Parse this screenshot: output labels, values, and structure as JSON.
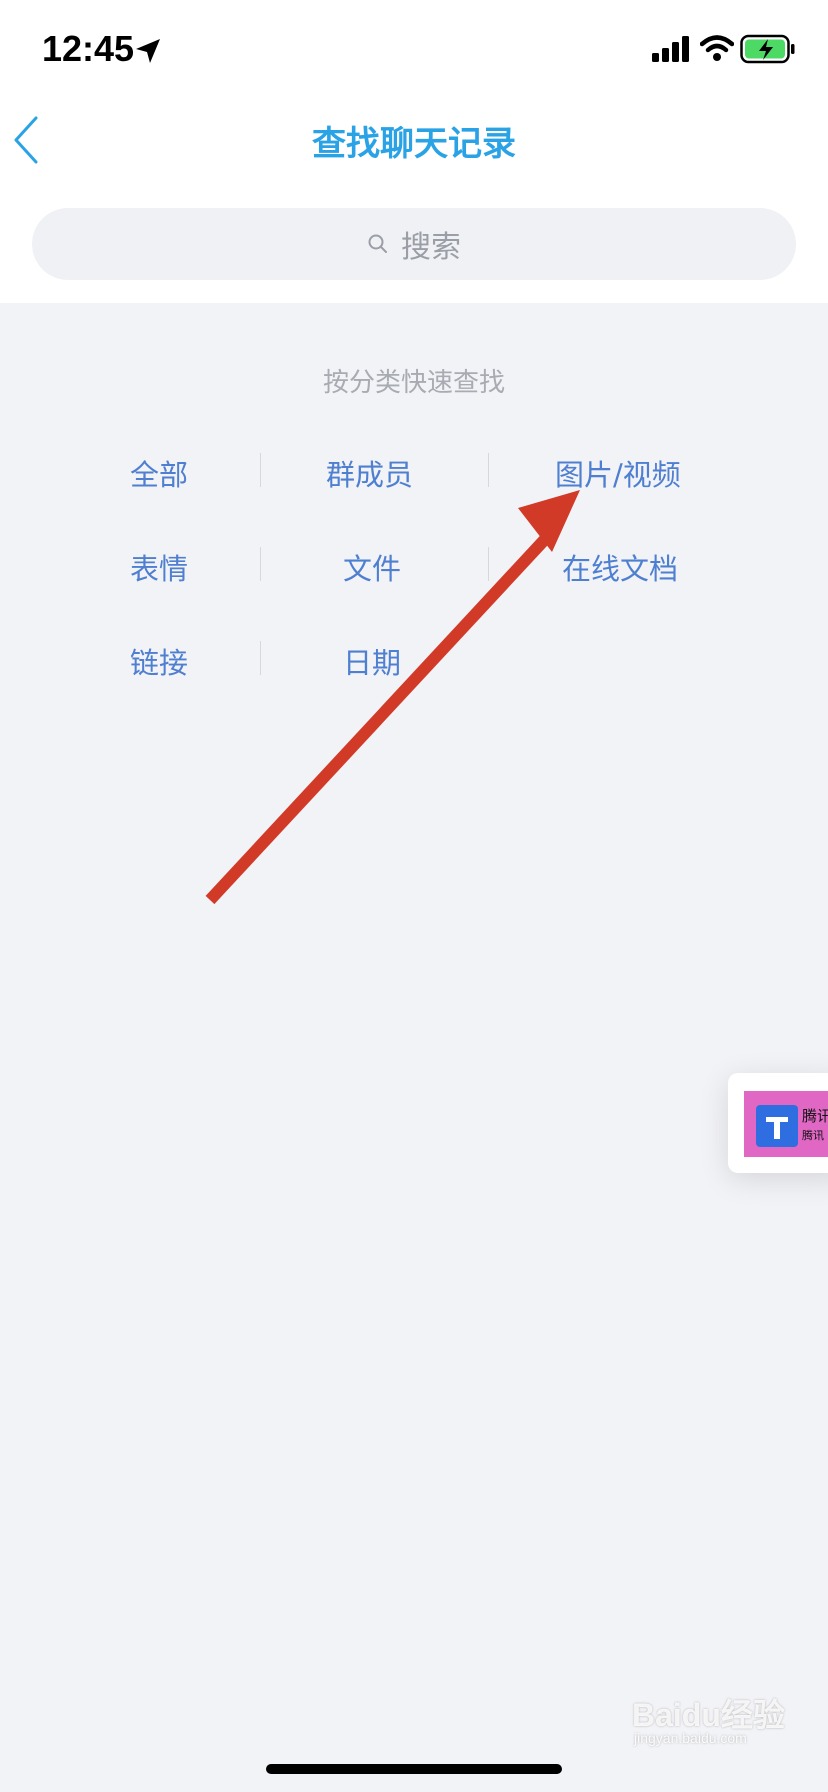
{
  "status_bar": {
    "time": "12:45"
  },
  "header": {
    "title": "查找聊天记录"
  },
  "search": {
    "placeholder": "搜索"
  },
  "categories": {
    "section_label": "按分类快速查找",
    "items": [
      {
        "label": "全部"
      },
      {
        "label": "群成员"
      },
      {
        "label": "图片/视频"
      },
      {
        "label": "表情"
      },
      {
        "label": "文件"
      },
      {
        "label": "在线文档"
      },
      {
        "label": "链接"
      },
      {
        "label": "日期"
      }
    ]
  },
  "floating_card": {
    "title": "腾讯",
    "subtitle": "腾讯"
  },
  "watermark": {
    "brand": "Baidu经验",
    "url": "jingyan.baidu.com"
  },
  "colors": {
    "title_blue": "#2aa2e6",
    "category_blue": "#4f7fd0",
    "annotation_red": "#d23a28",
    "background": "#f2f3f7"
  },
  "icons": {
    "back": "chevron-left-icon",
    "search": "search-icon",
    "location": "location-arrow-icon",
    "signal": "signal-icon",
    "wifi": "wifi-icon",
    "battery": "battery-charging-icon"
  }
}
